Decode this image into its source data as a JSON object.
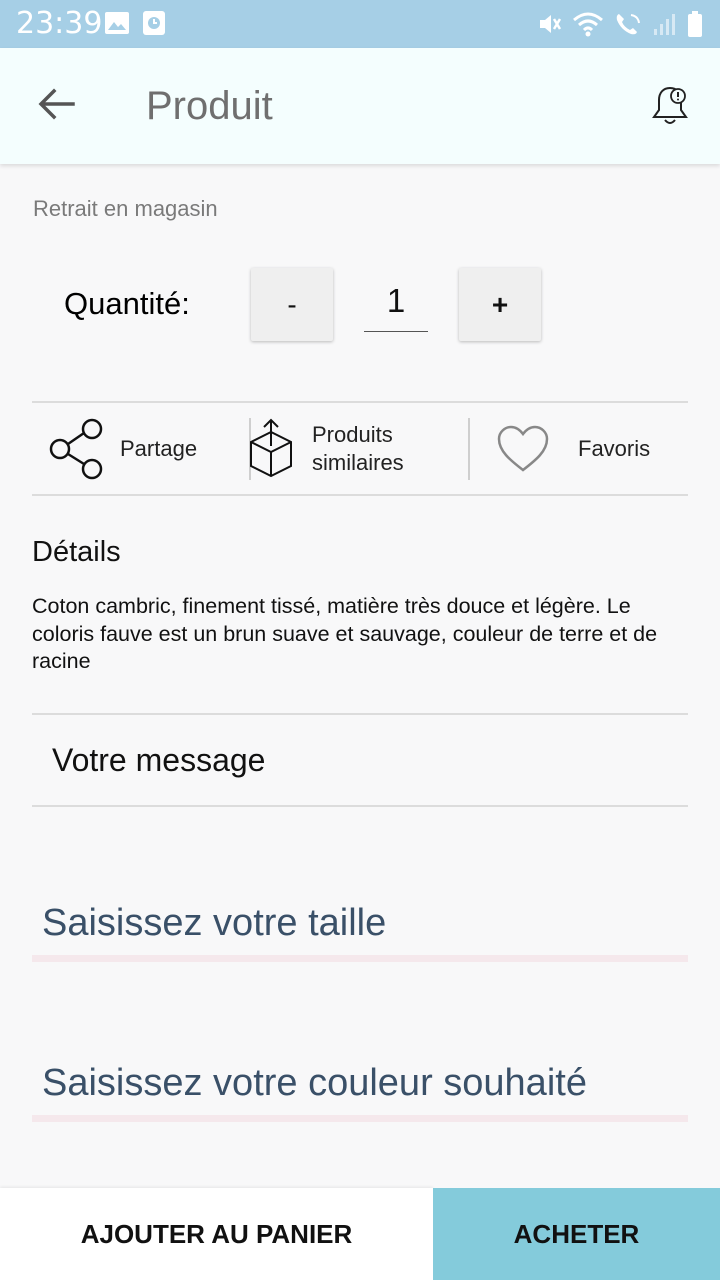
{
  "status_bar": {
    "time": "23:39",
    "icons": [
      "image-icon",
      "clock-app-icon",
      "mute-icon",
      "wifi-icon",
      "wifi-call-icon",
      "signal-icon",
      "battery-icon"
    ]
  },
  "app_bar": {
    "title": "Produit",
    "back_icon": "arrow-left-icon",
    "bell_icon": "bell-alert-icon"
  },
  "pickup_text": "Retrait en magasin",
  "quantity": {
    "label": "Quantité:",
    "minus_label": "-",
    "value": "1",
    "plus_label": "+"
  },
  "actions": {
    "share_label": "Partage",
    "similar_label_line1": "Produits",
    "similar_label_line2": "similaires",
    "favorites_label": "Favoris"
  },
  "details": {
    "title": "Détails",
    "text": "Coton cambric, finement tissé, matière très douce et légère. Le coloris fauve est un brun suave et sauvage, couleur de terre et de racine"
  },
  "message_label": "Votre message",
  "inputs": {
    "size_placeholder": "Saisissez votre taille",
    "color_placeholder": "Saisissez votre couleur souhaité"
  },
  "bottom": {
    "add_to_cart_label": "AJOUTER AU PANIER",
    "buy_label": "ACHETER"
  },
  "colors": {
    "status_bar": "#a6cfe6",
    "app_bar": "#f4fefe",
    "buy_button": "#84cbdb",
    "input_text": "#2f4662"
  }
}
